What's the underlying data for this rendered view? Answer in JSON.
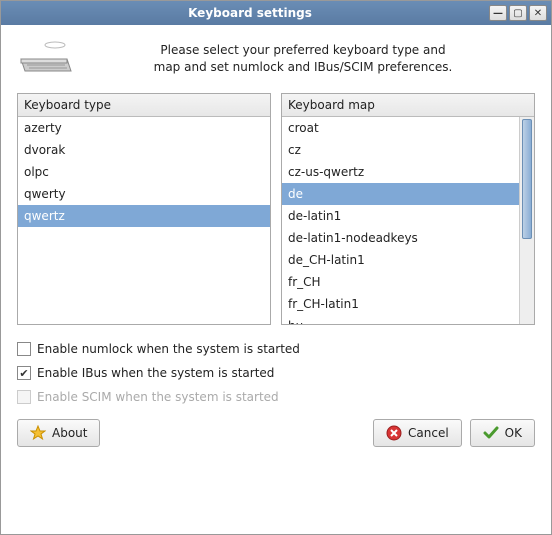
{
  "window": {
    "title": "Keyboard settings"
  },
  "intro": {
    "line1": "Please select your preferred keyboard type and",
    "line2": "map and set numlock and IBus/SCIM preferences."
  },
  "lists": {
    "type": {
      "header": "Keyboard type",
      "items": [
        "azerty",
        "dvorak",
        "olpc",
        "qwerty",
        "qwertz"
      ],
      "selected": "qwertz"
    },
    "map": {
      "header": "Keyboard map",
      "items": [
        "croat",
        "cz",
        "cz-us-qwertz",
        "de",
        "de-latin1",
        "de-latin1-nodeadkeys",
        "de_CH-latin1",
        "fr_CH",
        "fr_CH-latin1",
        "hu"
      ],
      "selected": "de"
    }
  },
  "checkboxes": {
    "numlock": {
      "label": "Enable numlock when the system is started",
      "checked": false,
      "enabled": true
    },
    "ibus": {
      "label": "Enable IBus when the system is started",
      "checked": true,
      "enabled": true
    },
    "scim": {
      "label": "Enable SCIM when the system is started",
      "checked": false,
      "enabled": false
    }
  },
  "buttons": {
    "about": "About",
    "cancel": "Cancel",
    "ok": "OK"
  }
}
